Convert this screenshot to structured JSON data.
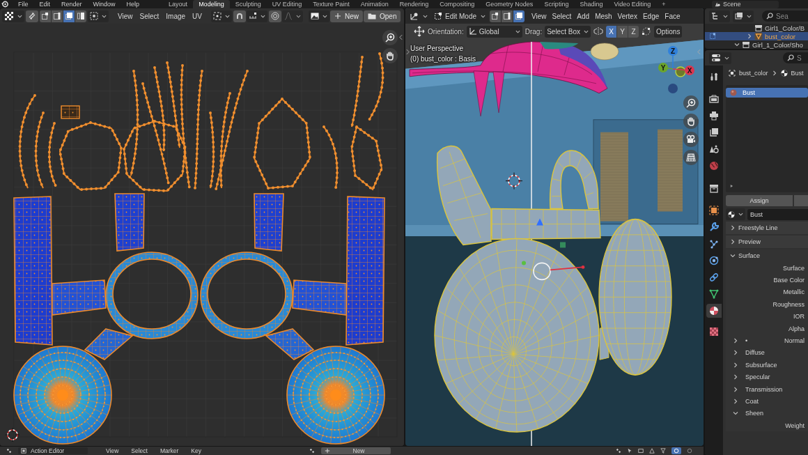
{
  "top_bar": {
    "menus": [
      "File",
      "Edit",
      "Render",
      "Window",
      "Help"
    ],
    "workspaces": [
      {
        "label": "Layout",
        "selected": false
      },
      {
        "label": "Modeling",
        "selected": true
      },
      {
        "label": "Sculpting",
        "selected": false
      },
      {
        "label": "UV Editing",
        "selected": false
      },
      {
        "label": "Texture Paint",
        "selected": false
      },
      {
        "label": "Animation",
        "selected": false
      },
      {
        "label": "Rendering",
        "selected": false
      },
      {
        "label": "Compositing",
        "selected": false
      },
      {
        "label": "Geometry Nodes",
        "selected": false
      },
      {
        "label": "Scripting",
        "selected": false
      },
      {
        "label": "Shading",
        "selected": false
      },
      {
        "label": "Video Editing",
        "selected": false
      }
    ],
    "add_workspace": "+",
    "scene": "Scene"
  },
  "uv_editor": {
    "select_modes": [
      {
        "selected": false
      },
      {
        "selected": false
      },
      {
        "selected": true
      },
      {
        "selected": false
      }
    ],
    "menus": [
      "View",
      "Select",
      "Image",
      "UV"
    ],
    "new_button": "New",
    "open_button": "Open"
  },
  "viewport": {
    "mode": "Edit Mode",
    "select_modes": [
      {
        "selected": false
      },
      {
        "selected": false
      },
      {
        "selected": true
      }
    ],
    "menus": [
      "View",
      "Select",
      "Add",
      "Mesh",
      "Vertex",
      "Edge",
      "Face"
    ],
    "orientation_label": "Orientation:",
    "orientation": "Global",
    "drag_label": "Drag:",
    "drag": "Select Box",
    "mirror_axes": [
      {
        "label": "X",
        "selected": true
      },
      {
        "label": "Y",
        "selected": false
      },
      {
        "label": "Z",
        "selected": false
      }
    ],
    "options": "Options",
    "info": [
      "User Perspective",
      "(0) bust_color : Basis"
    ],
    "gizmo_axes": [
      {
        "label": "Z",
        "color": "#2f80db"
      },
      {
        "label": "Y",
        "color": "#6ba52c"
      },
      {
        "label": "X",
        "color": "#db3650"
      }
    ]
  },
  "outliner": {
    "search_placeholder": "Sea",
    "tree": [
      {
        "children": [
          {
            "label": "Girl1_Color/B",
            "selected": false,
            "kind": "collection"
          },
          {
            "label": "bust_color",
            "selected": true,
            "kind": "mesh",
            "expanded": false
          }
        ]
      },
      {
        "label": "Girl_1_Color/Sho",
        "selected": false,
        "kind": "collection",
        "expanded": true
      }
    ]
  },
  "properties": {
    "search_placeholder": "S",
    "tabs": [
      {
        "kind": "tool",
        "selected": false
      },
      {
        "kind": "render",
        "selected": false
      },
      {
        "kind": "output",
        "selected": false
      },
      {
        "kind": "view_layer",
        "selected": false
      },
      {
        "kind": "scene",
        "selected": false
      },
      {
        "kind": "world",
        "selected": false
      },
      {
        "kind": "collection",
        "selected": false
      },
      {
        "kind": "object",
        "selected": false
      },
      {
        "kind": "modifiers",
        "selected": false
      },
      {
        "kind": "particles",
        "selected": false
      },
      {
        "kind": "physics",
        "selected": false
      },
      {
        "kind": "constraints",
        "selected": false
      },
      {
        "kind": "data",
        "selected": false
      },
      {
        "kind": "material",
        "selected": true
      },
      {
        "kind": "texture",
        "selected": false
      }
    ],
    "breadcrumb": [
      "bust_color",
      "Bust"
    ],
    "material_slots": [
      {
        "label": "Bust",
        "selected": true
      }
    ],
    "assign_button": "Assign",
    "material": "Bust",
    "panels": [
      {
        "label": "Freestyle Line",
        "expanded": false
      },
      {
        "label": "Preview",
        "expanded": false
      },
      {
        "label": "Surface",
        "expanded": true,
        "children": [
          {
            "kind": "field",
            "label": "Surface"
          },
          {
            "kind": "field",
            "label": "Base Color"
          },
          {
            "kind": "field",
            "label": "Metallic"
          },
          {
            "kind": "field",
            "label": "Roughness"
          },
          {
            "kind": "field",
            "label": "IOR"
          },
          {
            "kind": "field",
            "label": "Alpha"
          },
          {
            "kind": "socket",
            "label": "Normal",
            "bullet": "•",
            "expanded": false
          },
          {
            "kind": "subpanel",
            "label": "Diffuse",
            "expanded": false
          },
          {
            "kind": "subpanel",
            "label": "Subsurface",
            "expanded": false
          },
          {
            "kind": "subpanel",
            "label": "Specular",
            "expanded": false
          },
          {
            "kind": "subpanel",
            "label": "Transmission",
            "expanded": false
          },
          {
            "kind": "subpanel",
            "label": "Coat",
            "expanded": false
          },
          {
            "kind": "subpanel",
            "label": "Sheen",
            "expanded": true,
            "children": [
              {
                "kind": "field",
                "label": "Weight"
              }
            ]
          }
        ]
      }
    ]
  },
  "bottom_bar": {
    "editor": "Action Editor",
    "menus": [
      "View",
      "Select",
      "Marker",
      "Key"
    ],
    "new_button": "New"
  }
}
